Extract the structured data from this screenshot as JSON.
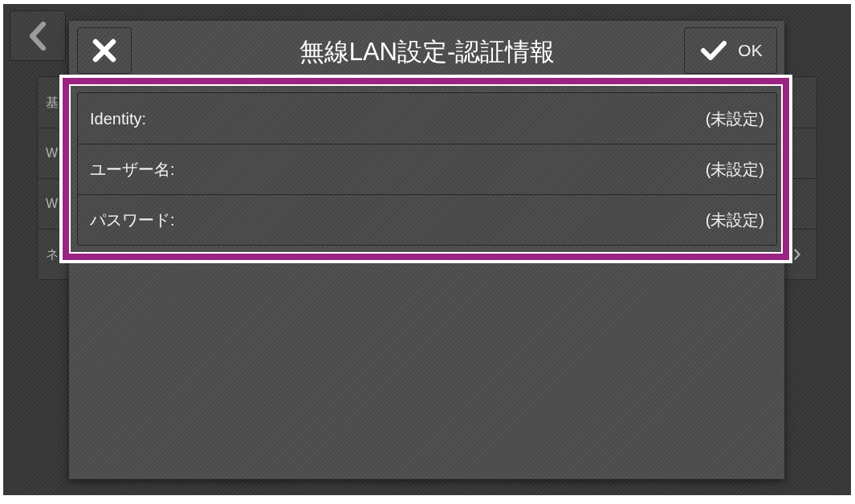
{
  "background_list": {
    "rows": [
      {
        "label": "基",
        "kind": "setting"
      },
      {
        "label": "W",
        "kind": "setting"
      },
      {
        "label": "W",
        "kind": "setting"
      },
      {
        "label": "ネ",
        "kind": "link"
      }
    ]
  },
  "dialog": {
    "title": "無線LAN設定-認証情報",
    "ok_button": {
      "label": "OK"
    },
    "fields_highlighted": true,
    "fields": [
      {
        "label": "Identity:",
        "value": "(未設定)"
      },
      {
        "label": "ユーザー名:",
        "value": "(未設定)"
      },
      {
        "label": "パスワード:",
        "value": "(未設定)"
      }
    ]
  }
}
